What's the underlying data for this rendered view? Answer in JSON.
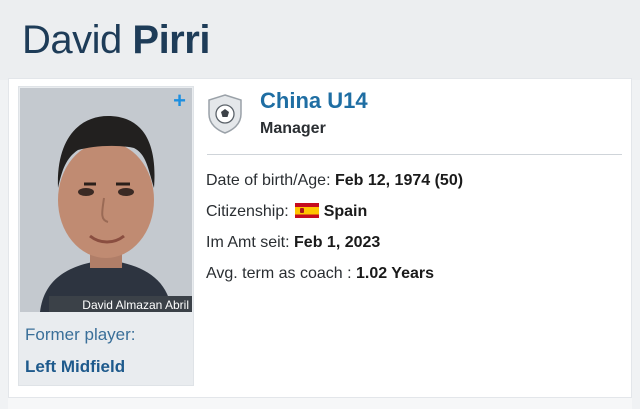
{
  "profile": {
    "first_name": "David",
    "last_name": "Pirri",
    "photo_caption": "David Almazan Abril",
    "former_label": "Former player:",
    "former_position": "Left Midfield"
  },
  "club": {
    "name": "China U14",
    "role": "Manager",
    "badge_icon": "football-club-badge-icon"
  },
  "details": {
    "dob_label": "Date of birth/Age:",
    "dob_value": "Feb 12, 1974 (50)",
    "citizenship_label": "Citizenship:",
    "citizenship_value": "Spain",
    "citizenship_flag": "spain-flag-icon",
    "appointed_label": "Im Amt seit:",
    "appointed_value": "Feb 1, 2023",
    "term_label": "Avg. term as coach :",
    "term_value": "1.02 Years"
  },
  "colors": {
    "link_blue": "#1f6ea3",
    "name_blue": "#1e3c58",
    "plus_blue": "#1d8fe0"
  }
}
